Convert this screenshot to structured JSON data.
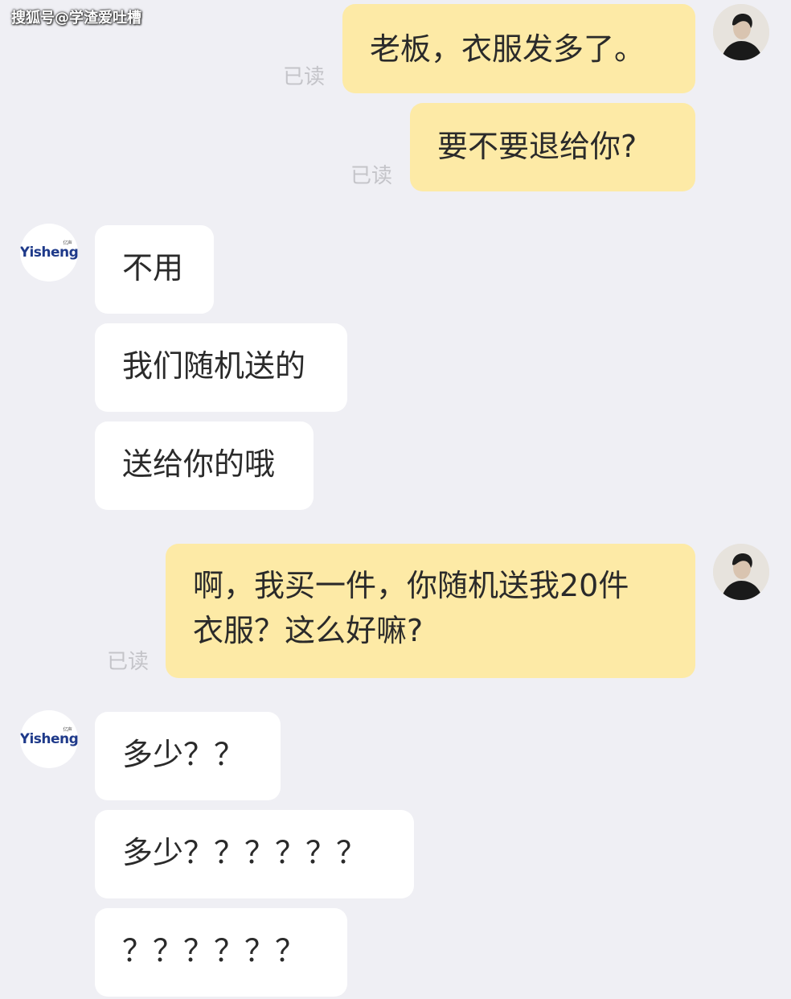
{
  "watermark": "搜狐号@学渣爱吐槽",
  "read_label": "已读",
  "shop_logo_text": "Yisheng",
  "shop_logo_small": "亿声",
  "messages": {
    "m1": "老板，衣服发多了。",
    "m2": "要不要退给你?",
    "m3": "不用",
    "m4": "我们随机送的",
    "m5": "送给你的哦",
    "m6_line1": "啊，我买一件，你随机送我20件",
    "m6_line2": "衣服？这么好嘛?",
    "m7": "多少？？",
    "m8": "多少？？？？？？",
    "m9": "？？？？？？"
  }
}
